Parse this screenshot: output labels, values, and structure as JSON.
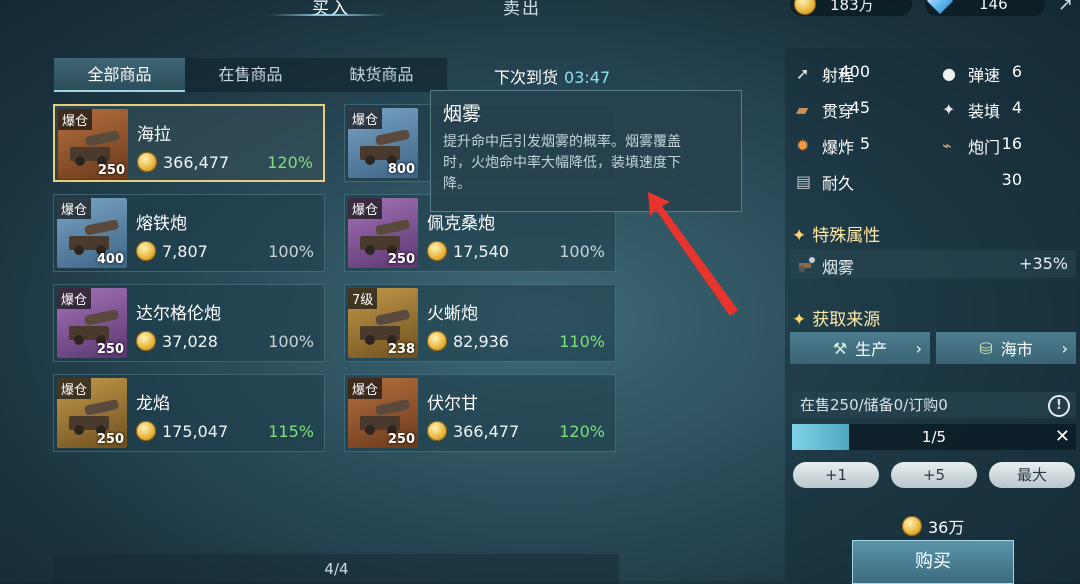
{
  "top_tabs": {
    "buy": "买入",
    "sell": "卖出"
  },
  "currency": {
    "coins": "183万",
    "diamonds": "146"
  },
  "sub_tabs": [
    "全部商品",
    "在售商品",
    "缺货商品"
  ],
  "restock": {
    "label": "下次到货",
    "time": "03:47"
  },
  "cards": [
    {
      "tag": "爆仓",
      "qty": "250",
      "name": "海拉",
      "price": "366,477",
      "pct": "120%",
      "color": "orange",
      "green": true
    },
    {
      "tag": "爆仓",
      "qty": "800",
      "name": "",
      "price": "",
      "pct": "",
      "color": "blue",
      "green": false
    },
    {
      "tag": "爆仓",
      "qty": "400",
      "name": "熔铁炮",
      "price": "7,807",
      "pct": "100%",
      "color": "blue",
      "green": false
    },
    {
      "tag": "爆仓",
      "qty": "250",
      "name": "佩克桑炮",
      "price": "17,540",
      "pct": "100%",
      "color": "purple",
      "green": false
    },
    {
      "tag": "爆仓",
      "qty": "250",
      "name": "达尔格伦炮",
      "price": "37,028",
      "pct": "100%",
      "color": "purple",
      "green": false
    },
    {
      "tag": "7级",
      "qty": "238",
      "name": "火蜥炮",
      "price": "82,936",
      "pct": "110%",
      "color": "gold",
      "green": true
    },
    {
      "tag": "爆仓",
      "qty": "250",
      "name": "龙焰",
      "price": "175,047",
      "pct": "115%",
      "color": "gold",
      "green": true
    },
    {
      "tag": "爆仓",
      "qty": "250",
      "name": "伏尔甘",
      "price": "366,477",
      "pct": "120%",
      "color": "orange",
      "green": true
    }
  ],
  "tooltip": {
    "title": "烟雾",
    "lines": [
      "提升命中后引发烟雾的概率。烟雾覆盖",
      "时，火炮命中率大幅降低，装填速度下",
      "降。"
    ]
  },
  "pager": "4/4",
  "stats": [
    {
      "label": "射程",
      "value": "400",
      "icon": "range-icon"
    },
    {
      "label": "弹速",
      "value": "6",
      "icon": "projectile-speed-icon"
    },
    {
      "label": "贯穿",
      "value": "45",
      "icon": "penetration-icon"
    },
    {
      "label": "装填",
      "value": "4",
      "icon": "reload-icon"
    },
    {
      "label": "爆炸",
      "value": "5",
      "icon": "explosion-icon"
    },
    {
      "label": "炮门",
      "value": "16",
      "icon": "gunport-icon"
    },
    {
      "label": "耐久",
      "value": "30",
      "icon": "durability-icon"
    }
  ],
  "special": {
    "title": "特殊属性",
    "attr_label": "烟雾",
    "attr_value": "+35%"
  },
  "source": {
    "title": "获取来源",
    "production": "生产",
    "market": "海市"
  },
  "stock_line": "在售250/储备0/订购0",
  "progress": {
    "text": "1/5",
    "fraction": 0.2
  },
  "quick_buttons": [
    "+1",
    "+5",
    "最大"
  ],
  "total_price": "36万",
  "buy_label": "购买",
  "colors": {
    "accent": "#8fe0f0",
    "gold": "#e6cf7a",
    "green": "#7ee07a",
    "section": "#ffe9a6"
  }
}
